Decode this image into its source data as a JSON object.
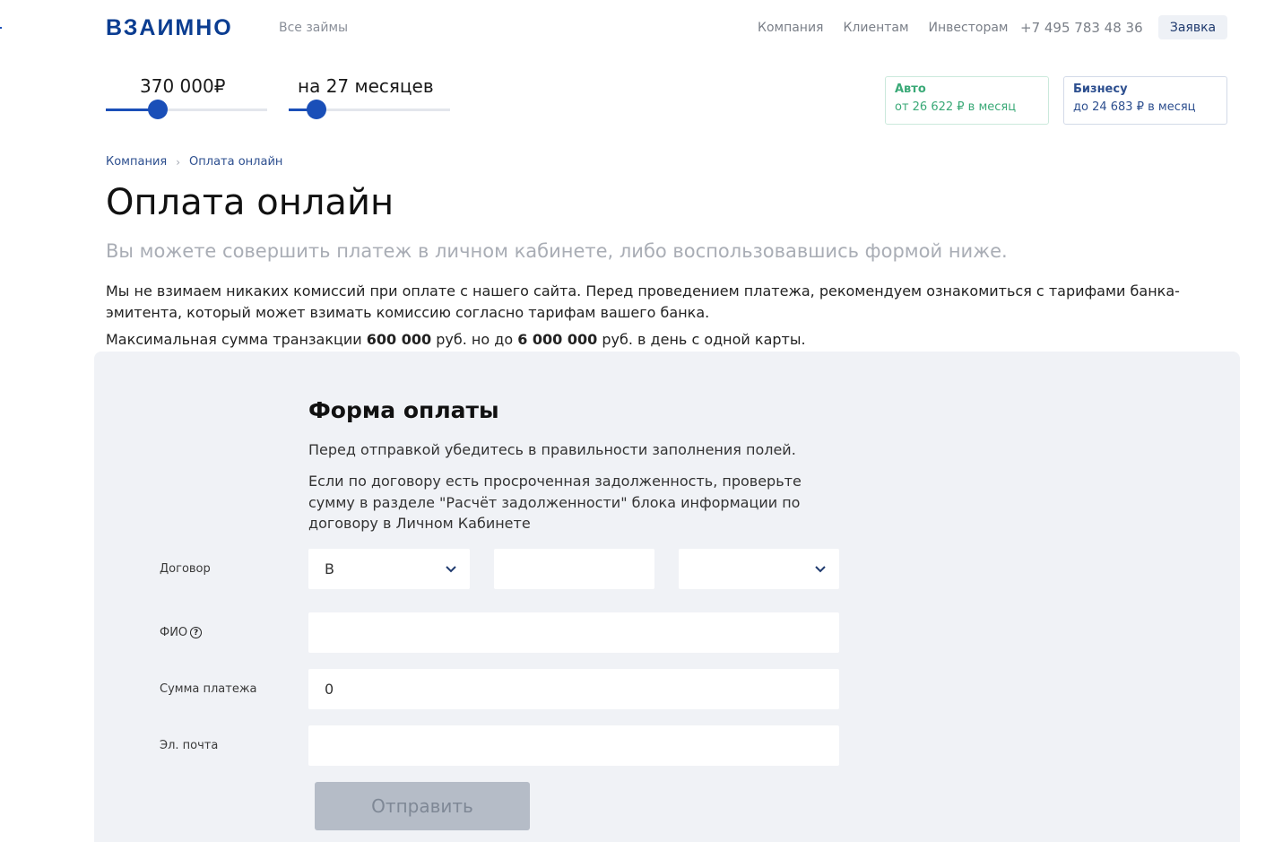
{
  "header": {
    "logo": "ВЗАИМНО",
    "all_loans": "Все займы",
    "nav": [
      "Компания",
      "Клиентам",
      "Инвесторам"
    ],
    "phone": "+7 495 783 48 36",
    "apply_label": "Заявка"
  },
  "calculator": {
    "amount_label": "370 000₽",
    "amount_fraction": 0.32,
    "term_label": "на 27 месяцев",
    "term_fraction": 0.17,
    "accent_color": "#1a4fb8"
  },
  "offers": {
    "auto": {
      "title": "Авто",
      "text": "от 26 622 ₽ в месяц",
      "color": "#3aa977"
    },
    "business": {
      "title": "Бизнесу",
      "text": "до 24 683 ₽ в месяц",
      "color": "#2d4f8f"
    }
  },
  "breadcrumb": {
    "items": [
      "Компания",
      "Оплата онлайн"
    ]
  },
  "page": {
    "title": "Оплата онлайн",
    "lead": "Вы можете совершить платеж в личном кабинете, либо воспользовавшись формой ниже.",
    "paragraph": "Мы не взимаем никаких комиссий при оплате с нашего сайта. Перед проведением платежа, рекомендуем ознакомиться с тарифами банка-эмитента, который может взимать комиссию согласно тарифам вашего банка.",
    "limit_prefix": "Максимальная сумма транзакции",
    "limit_max": "600 000",
    "limit_mid": "руб. но до",
    "limit_day": "6 000 000",
    "limit_suffix": "руб. в день с одной карты."
  },
  "form": {
    "title": "Форма оплаты",
    "hint1": "Перед отправкой убедитесь в правильности заполнения полей.",
    "hint2": "Если по договору есть просроченная задолженность, проверьте сумму в разделе \"Расчёт задолженности\" блока информации по договору в Личном Кабинете",
    "contract_label": "Договор",
    "contract_prefix_value": "В",
    "contract_number_value": "",
    "contract_suffix_value": "",
    "fio_label": "ФИО",
    "fio_help_icon": "?",
    "fio_value": "",
    "amount_label": "Сумма платежа",
    "amount_value": "0",
    "email_label": "Эл. почта",
    "email_value": "",
    "submit_label": "Отправить"
  }
}
